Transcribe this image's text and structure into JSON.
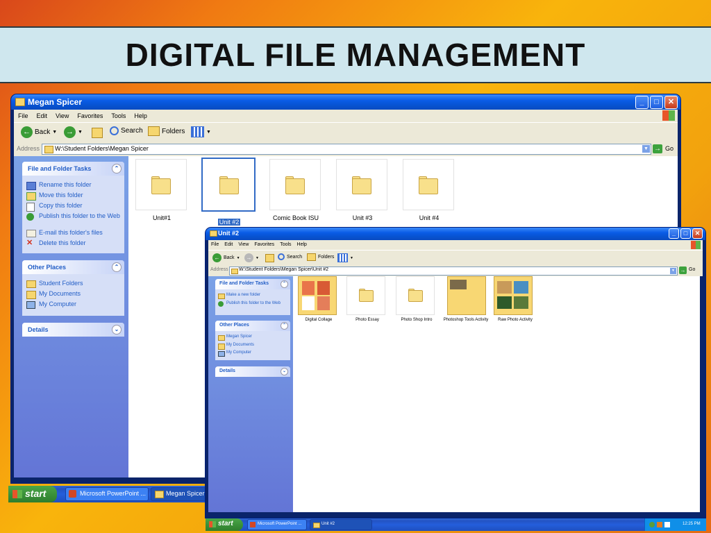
{
  "slide": {
    "title": "DIGITAL FILE MANAGEMENT"
  },
  "window1": {
    "title": "Megan Spicer",
    "menu": [
      "File",
      "Edit",
      "View",
      "Favorites",
      "Tools",
      "Help"
    ],
    "toolbar": {
      "back": "Back",
      "search": "Search",
      "folders": "Folders"
    },
    "address": {
      "label": "Address",
      "value": "W:\\Student Folders\\Megan Spicer",
      "go": "Go"
    },
    "tasks_panel": {
      "title": "File and Folder Tasks",
      "items": [
        "Rename this folder",
        "Move this folder",
        "Copy this folder",
        "Publish this folder to the Web",
        "E-mail this folder's files",
        "Delete this folder"
      ]
    },
    "other_places": {
      "title": "Other Places",
      "items": [
        "Student Folders",
        "My Documents",
        "My Computer"
      ]
    },
    "details": {
      "title": "Details"
    },
    "folders": [
      "Unit#1",
      "Unit #2",
      "Comic Book ISU",
      "Unit #3",
      "Unit #4"
    ]
  },
  "window2": {
    "title": "Unit #2",
    "menu": [
      "File",
      "Edit",
      "View",
      "Favorites",
      "Tools",
      "Help"
    ],
    "toolbar": {
      "back": "Back",
      "search": "Search",
      "folders": "Folders"
    },
    "address": {
      "label": "Address",
      "value": "W:\\Student Folders\\Megan Spicer\\Unit #2",
      "go": "Go"
    },
    "tasks_panel": {
      "title": "File and Folder Tasks",
      "items": [
        "Make a new folder",
        "Publish this folder to the Web"
      ]
    },
    "other_places": {
      "title": "Other Places",
      "items": [
        "Megan Spicer",
        "My Documents",
        "My Computer"
      ]
    },
    "details": {
      "title": "Details"
    },
    "folders": [
      "Digital Collage",
      "Photo Essay",
      "Photo Shop Intro",
      "Photoshop Tools Activity",
      "Raw Photo Activity"
    ]
  },
  "taskbar1": {
    "start": "start",
    "buttons": [
      "Microsoft PowerPoint ...",
      "Megan Spicer"
    ]
  },
  "taskbar2": {
    "start": "start",
    "buttons": [
      "Microsoft PowerPoint ...",
      "Unit #2"
    ],
    "clock": "12:25 PM"
  }
}
